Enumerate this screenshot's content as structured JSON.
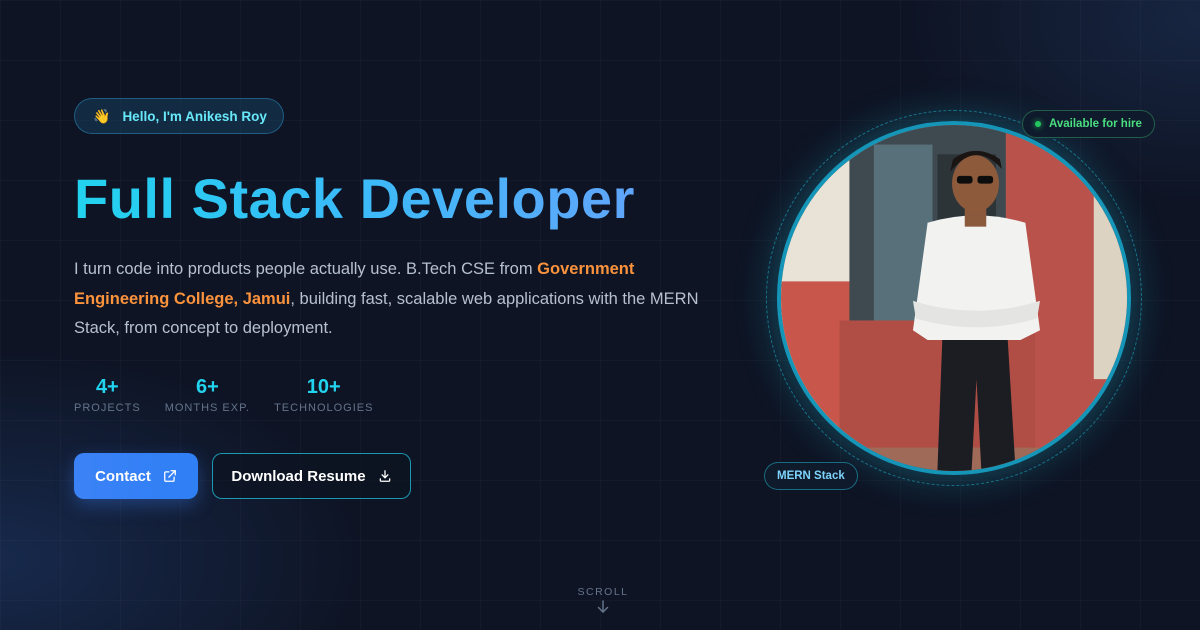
{
  "hero": {
    "greeting_icon": "waving-hand-icon",
    "greeting_emoji": "👋",
    "greeting": "Hello, I'm Anikesh Roy",
    "title": "Full Stack Developer",
    "intro": {
      "before": "I turn code into products people actually use. B.Tech CSE from ",
      "highlight": "Government Engineering College, Jamui",
      "after": ", building fast, scalable web applications with the MERN Stack, from concept to deployment."
    },
    "stats": [
      {
        "value": "4+",
        "label": "PROJECTS"
      },
      {
        "value": "6+",
        "label": "MONTHS EXP."
      },
      {
        "value": "10+",
        "label": "TECHNOLOGIES"
      }
    ],
    "buttons": {
      "contact": {
        "label": "Contact",
        "icon": "external-link-icon"
      },
      "resume": {
        "label": "Download Resume",
        "icon": "download-icon"
      }
    }
  },
  "profile": {
    "badge_available": "Available for hire",
    "badge_stack": "MERN Stack"
  },
  "scroll": {
    "label": "SCROLL",
    "icon": "arrow-down-icon"
  },
  "colors": {
    "accent_cyan": "#22d3ee",
    "accent_blue": "#3b82f6",
    "highlight_orange": "#fb923c",
    "available_green": "#4ade80",
    "background": "#0e1424"
  }
}
